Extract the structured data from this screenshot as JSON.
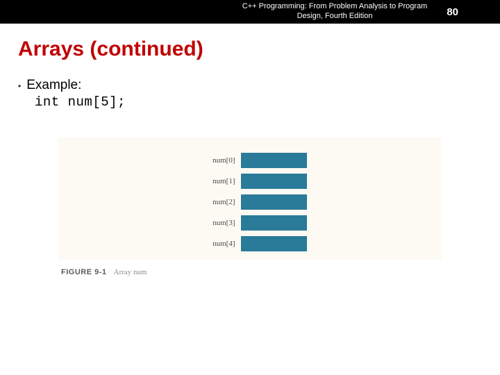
{
  "header": {
    "book_title_line1": "C++ Programming: From Problem Analysis to Program",
    "book_title_line2": "Design, Fourth Edition",
    "page_number": "80"
  },
  "slide": {
    "title": "Arrays (continued)",
    "bullet_label": "Example:",
    "code_line": "int num[5];"
  },
  "figure": {
    "labels": [
      "num[0]",
      "num[1]",
      "num[2]",
      "num[3]",
      "num[4]"
    ],
    "caption_tag": "FIGURE 9-1",
    "caption_text": "Array num"
  }
}
